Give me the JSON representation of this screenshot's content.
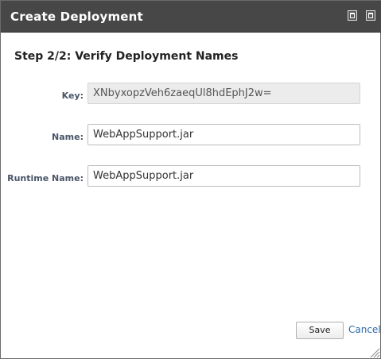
{
  "dialog": {
    "title": "Create Deployment",
    "controls": {
      "maximize_icon": "maximize-icon",
      "restore_icon": "restore-icon"
    }
  },
  "step": {
    "title": "Step 2/2: Verify Deployment Names"
  },
  "form": {
    "key": {
      "label": "Key:",
      "value": "XNbyxopzVeh6zaeqUl8hdEphJ2w="
    },
    "name": {
      "label": "Name:",
      "value": "WebAppSupport.jar"
    },
    "runtime_name": {
      "label": "Runtime Name:",
      "value": "WebAppSupport.jar"
    }
  },
  "actions": {
    "save_label": "Save",
    "cancel_label": "Cancel"
  },
  "colors": {
    "titlebar": "#474747",
    "label": "#4a5568",
    "link": "#2c6aa8"
  }
}
